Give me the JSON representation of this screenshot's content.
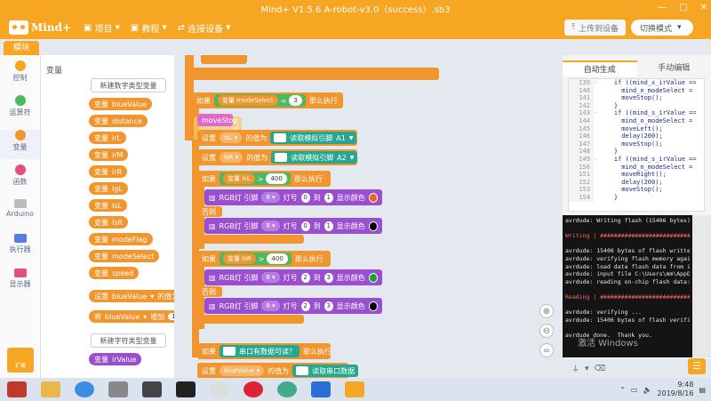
{
  "window": {
    "title": "Mind+ V1.5.6     A-robot-v3.0（success）.sb3",
    "controls": [
      "—",
      "□",
      "✕"
    ]
  },
  "menubar": {
    "logo": "Mind+",
    "items": [
      "项目",
      "教程",
      "连接设备"
    ],
    "upload_label": "上传到设备",
    "mode_label": "切换模式"
  },
  "editor_tab": "模块",
  "categories": [
    {
      "label": "控制",
      "color": "#f6a623"
    },
    {
      "label": "运算符",
      "color": "#4db85f"
    },
    {
      "label": "变量",
      "color": "#f1962f"
    },
    {
      "label": "函数",
      "color": "#e0527a"
    },
    {
      "label": "Arduino",
      "color": "#9aa3b0"
    },
    {
      "label": "执行器",
      "color": "#5a7be0"
    },
    {
      "label": "显示器",
      "color": "#e0527a"
    }
  ],
  "sidebar_bottom_label": "扩展",
  "palette": {
    "caption": "变量",
    "new_number_var": "新建数字类型变量",
    "vars": [
      "blueValue",
      "distance",
      "irL",
      "irM",
      "irR",
      "lgL",
      "lsL",
      "lsR",
      "modeFlag",
      "modeSelect",
      "speed"
    ],
    "var_prefix": "变量",
    "set_block": {
      "prefix": "设置",
      "var": "blueValue",
      "mid": "的值为",
      "value": "0"
    },
    "change_block": {
      "prefix": "将",
      "var": "blueValue",
      "mid": "增加",
      "value": "1"
    },
    "new_string_var": "新建字符类型变量",
    "string_var": "irValue"
  },
  "canvas": {
    "if_modeselect": {
      "if": "如果",
      "var_label": "变量",
      "var": "modeSelect",
      "eq": "=",
      "value": "3",
      "then": "那么执行"
    },
    "movestop": "moveStop",
    "set_lsl": {
      "set": "设置",
      "var": "lsL",
      "mid": "的值为",
      "read": "读取模拟引脚",
      "pin": "A1"
    },
    "set_lsr": {
      "set": "设置",
      "var": "lsR",
      "mid": "的值为",
      "read": "读取模拟引脚",
      "pin": "A2"
    },
    "if_lsl": {
      "if": "如果",
      "var_label": "变量",
      "var": "lsL",
      "op": ">",
      "value": "400",
      "then": "那么执行"
    },
    "rgb1": {
      "label": "RGB灯 引脚",
      "pin": "8",
      "lamp": "灯号",
      "from": "0",
      "to_label": "到",
      "to": "1",
      "show": "显示颜色"
    },
    "else1": "否则",
    "rgb2": {
      "label": "RGB灯 引脚",
      "pin": "8",
      "lamp": "灯号",
      "from": "0",
      "to_label": "到",
      "to": "1",
      "show": "显示颜色"
    },
    "if_lsr": {
      "if": "如果",
      "var_label": "变量",
      "var": "lsR",
      "op": ">",
      "value": "400",
      "then": "那么执行"
    },
    "rgb3": {
      "label": "RGB灯 引脚",
      "pin": "8",
      "lamp": "灯号",
      "from": "2",
      "to_label": "到",
      "to": "3",
      "show": "显示颜色"
    },
    "else2": "否则",
    "rgb4": {
      "label": "RGB灯 引脚",
      "pin": "8",
      "lamp": "灯号",
      "from": "2",
      "to_label": "到",
      "to": "3",
      "show": "显示颜色"
    },
    "if_serial": {
      "if": "如果",
      "cond": "串口有数据可读？",
      "then": "那么执行"
    },
    "set_blue": {
      "set": "设置",
      "var": "blueValue",
      "mid": "的值为",
      "read": "读取串口数据"
    },
    "colors": {
      "orange": "#f06523",
      "black": "#000000",
      "green": "#1f9e3b"
    }
  },
  "zoom": [
    "⊕",
    "⊖",
    "="
  ],
  "right_panel": {
    "tab_auto": "自动生成",
    "tab_manual": "手动编辑",
    "code_lines": [
      {
        "n": "139",
        "f": "-",
        "t": "    if ((mind_s_irValue =="
      },
      {
        "n": "140",
        "f": "",
        "t": "      mind_n_modeSelect ="
      },
      {
        "n": "141",
        "f": "",
        "t": "      moveStop();"
      },
      {
        "n": "142",
        "f": "",
        "t": "    }"
      },
      {
        "n": "143",
        "f": "-",
        "t": "    if ((mind_s_irValue =="
      },
      {
        "n": "144",
        "f": "",
        "t": "      mind_n_modeSelect ="
      },
      {
        "n": "145",
        "f": "",
        "t": "      moveLeft();"
      },
      {
        "n": "146",
        "f": "",
        "t": "      delay(200);"
      },
      {
        "n": "147",
        "f": "",
        "t": "      moveStop();"
      },
      {
        "n": "148",
        "f": "",
        "t": "    }"
      },
      {
        "n": "149",
        "f": "-",
        "t": "    if ((mind_s_irValue =="
      },
      {
        "n": "150",
        "f": "",
        "t": "      mind_n_modeSelect ="
      },
      {
        "n": "151",
        "f": "",
        "t": "      moveRight();"
      },
      {
        "n": "152",
        "f": "",
        "t": "      delay(200);"
      },
      {
        "n": "153",
        "f": "",
        "t": "      moveStop();"
      },
      {
        "n": "154",
        "f": "",
        "t": "    }"
      }
    ],
    "console_lines": [
      {
        "t": "avrdude: Writing flash (15406 bytes):",
        "red": false
      },
      {
        "t": "",
        "red": false
      },
      {
        "t": "Writing | ################################",
        "red": true
      },
      {
        "t": "",
        "red": false
      },
      {
        "t": "avrdude: 15406 bytes of flash written",
        "red": false
      },
      {
        "t": "avrdude: verifying flash memory against",
        "red": false
      },
      {
        "t": "avrdude: load data flash data from input",
        "red": false
      },
      {
        "t": "avrdude: input file C:\\Users\\mm\\AppData",
        "red": false
      },
      {
        "t": "avrdude: reading on-chip flash data:",
        "red": false
      },
      {
        "t": "",
        "red": false
      },
      {
        "t": "Reading | ################################",
        "red": true
      },
      {
        "t": "",
        "red": false
      },
      {
        "t": "avrdude: verifying ...",
        "red": false
      },
      {
        "t": "avrdude: 15406 bytes of flash verified",
        "red": false
      },
      {
        "t": "",
        "red": false
      },
      {
        "t": "avrdude done.  Thank you.",
        "red": false
      }
    ],
    "watermark": "激活 Windows"
  },
  "taskbar": {
    "time": "9:48",
    "date": "2019/8/16"
  }
}
